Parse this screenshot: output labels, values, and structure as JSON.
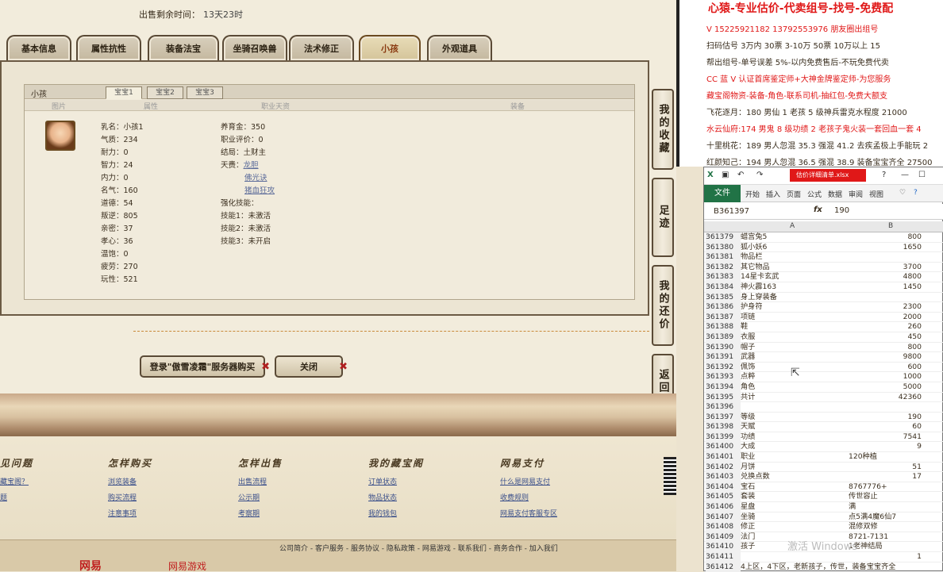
{
  "game": {
    "sale_timer_label": "出售剩余时间：",
    "sale_timer_value": "13天23时",
    "tabs": [
      "基本信息",
      "属性抗性",
      "装备法宝",
      "坐骑召唤兽",
      "法术修正",
      "小孩",
      "外观道具"
    ],
    "active_tab": "小孩",
    "panel_title": "小孩",
    "subtabs": [
      "宝宝1",
      "宝宝2",
      "宝宝3"
    ],
    "columns": [
      "图片",
      "属性",
      "职业天资",
      "装备"
    ],
    "kid_attrs": [
      {
        "label": "乳名：",
        "value": "小孩1"
      },
      {
        "label": "气质：",
        "value": "234"
      },
      {
        "label": "耐力：",
        "value": "0"
      },
      {
        "label": "智力：",
        "value": "24"
      },
      {
        "label": "内力：",
        "value": "0"
      },
      {
        "label": "名气：",
        "value": "160"
      },
      {
        "label": "道德：",
        "value": "54"
      },
      {
        "label": "叛逆：",
        "value": "805"
      },
      {
        "label": "亲密：",
        "value": "37"
      },
      {
        "label": "孝心：",
        "value": "36"
      },
      {
        "label": "温饱：",
        "value": "0"
      },
      {
        "label": "疲劳：",
        "value": "270"
      },
      {
        "label": "玩性：",
        "value": "521"
      }
    ],
    "career": {
      "nurture_label": "养育金：",
      "nurture_value": "350",
      "rating_label": "职业评价：",
      "rating_value": "0",
      "ending_label": "结局：",
      "ending_value": "土财主",
      "talent_label": "天赉：",
      "talents": [
        "龙胆",
        "佛光诀",
        "猪血狂攻"
      ],
      "skills_label": "强化技能：",
      "skills": [
        "技能1：未激活",
        "技能2：未激活",
        "技能3：未开启"
      ]
    },
    "side_buttons": [
      "我的收藏",
      "足迹",
      "我的还价",
      "返回顶部"
    ],
    "buy_button": "登录\"傲雪凌霜\"服务器购买",
    "close_button": "关闭",
    "footer": {
      "cols": [
        {
          "h": "见问题",
          "links": [
            "藏宝阁？",
            "题"
          ]
        },
        {
          "h": "怎样购买",
          "links": [
            "浏览装备",
            "购买流程",
            "注意事项"
          ]
        },
        {
          "h": "怎样出售",
          "links": [
            "出售流程",
            "公示期",
            "考察期"
          ]
        },
        {
          "h": "我的藏宝阁",
          "links": [
            "订单状态",
            "物品状态",
            "我的钱包"
          ]
        },
        {
          "h": "网易支付",
          "links": [
            "什么是网易支付",
            "收费规则",
            "网易支付客服专区"
          ]
        }
      ],
      "bar_links": "公司简介 - 客户服务 - 服务协议 - 隐私政策 - 网易游戏 - 联系我们 - 商务合作 - 加入我们",
      "logo1": "网易",
      "logo2": "网易游戏"
    }
  },
  "ad": {
    "title": "心猿-专业估价-代卖组号-找号-免费配",
    "lines": [
      {
        "t": "V 15225921182   13792553976 朋友圈出组号",
        "c": "red"
      },
      {
        "t": "扫码估号 3万内 30票 3-10万 50票 10万以上 15",
        "c": "black"
      },
      {
        "t": "帮出组号-单号误差 5%-以内免费售后-不玩免费代卖",
        "c": "black"
      },
      {
        "t": "CC 蓝 V 认证首席鉴定师+大神金牌鉴定师-为您服务",
        "c": "red"
      },
      {
        "t": "藏宝阁物资-装备-角色-联系司机-抽红包-免费大额支",
        "c": "red"
      },
      {
        "t": "飞花逐月：180 男仙 1 老孩 5 级神兵雷克水程度 21000",
        "c": "black"
      },
      {
        "t": "水云仙府:174 男鬼 8 级功绩 2 老孩子鬼火装一套回血一套 4",
        "c": "red"
      },
      {
        "t": "十里桃花：189 男人忽混 35.3 强混 41.2 去疾孟极上手能玩 2",
        "c": "black"
      },
      {
        "t": "红颜知己：194 男人忽混 36.5 强混 38.9 装备宝宝齐全 27500",
        "c": "black"
      }
    ]
  },
  "excel": {
    "filename": "估价详细清单.xlsx",
    "ribbon_tabs": [
      "文件",
      "开始",
      "插入",
      "页面",
      "公式",
      "数据",
      "审阅",
      "视图"
    ],
    "cell_ref": "B361397",
    "formula_value": "190",
    "col_headers": [
      "A",
      "B"
    ],
    "rows": [
      {
        "n": "361379",
        "a": "蜡宫兔5",
        "b": "800"
      },
      {
        "n": "361380",
        "a": "狐小妖6",
        "b": "1650"
      },
      {
        "n": "361381",
        "a": "物品栏",
        "b": ""
      },
      {
        "n": "361382",
        "a": "其它物品",
        "b": "3700"
      },
      {
        "n": "361383",
        "a": "14星卡玄武",
        "b": "4800"
      },
      {
        "n": "361384",
        "a": "神火霹163",
        "b": "1450"
      },
      {
        "n": "361385",
        "a": "身上穿装备",
        "b": ""
      },
      {
        "n": "361386",
        "a": "护身符",
        "b": "2300"
      },
      {
        "n": "361387",
        "a": "项链",
        "b": "2000"
      },
      {
        "n": "361388",
        "a": "鞋",
        "b": "260"
      },
      {
        "n": "361389",
        "a": "衣服",
        "b": "450"
      },
      {
        "n": "361390",
        "a": "帽子",
        "b": "800"
      },
      {
        "n": "361391",
        "a": "武器",
        "b": "9800"
      },
      {
        "n": "361392",
        "a": "佩饰",
        "b": "600"
      },
      {
        "n": "361393",
        "a": "点粹",
        "b": "1000"
      },
      {
        "n": "361394",
        "a": "角色",
        "b": "5000"
      },
      {
        "n": "361395",
        "a": "共计",
        "b": "42360"
      },
      {
        "n": "361396",
        "a": "",
        "b": ""
      },
      {
        "n": "361397",
        "a": "等级",
        "b": "190"
      },
      {
        "n": "361398",
        "a": "天赋",
        "b": "60"
      },
      {
        "n": "361399",
        "a": "功绩",
        "b": "7541"
      },
      {
        "n": "361400",
        "a": "大成",
        "b": "9"
      },
      {
        "n": "361401",
        "a": "职业",
        "bt": "120种植"
      },
      {
        "n": "361402",
        "a": "月饼",
        "b": "51"
      },
      {
        "n": "361403",
        "a": "兑换点数",
        "b": "17"
      },
      {
        "n": "361404",
        "a": "宝石",
        "bt": "8767776+"
      },
      {
        "n": "361405",
        "a": "套装",
        "bt": "传世容止"
      },
      {
        "n": "361406",
        "a": "星盘",
        "bt": "满"
      },
      {
        "n": "361407",
        "a": "坐骑",
        "bt": "点5满4魔6仙7"
      },
      {
        "n": "361408",
        "a": "修正",
        "bt": "混修双修"
      },
      {
        "n": "361409",
        "a": "法门",
        "bt": "8721-7131"
      },
      {
        "n": "361410",
        "a": "孩子",
        "bt": "1老神结局"
      },
      {
        "n": "361411",
        "a": "",
        "b": "1"
      },
      {
        "n": "361412",
        "a": "4上区，4下区，老新孩子，传世，装备宝宝齐全",
        "b": ""
      }
    ],
    "watermark": "激活 Windows"
  }
}
